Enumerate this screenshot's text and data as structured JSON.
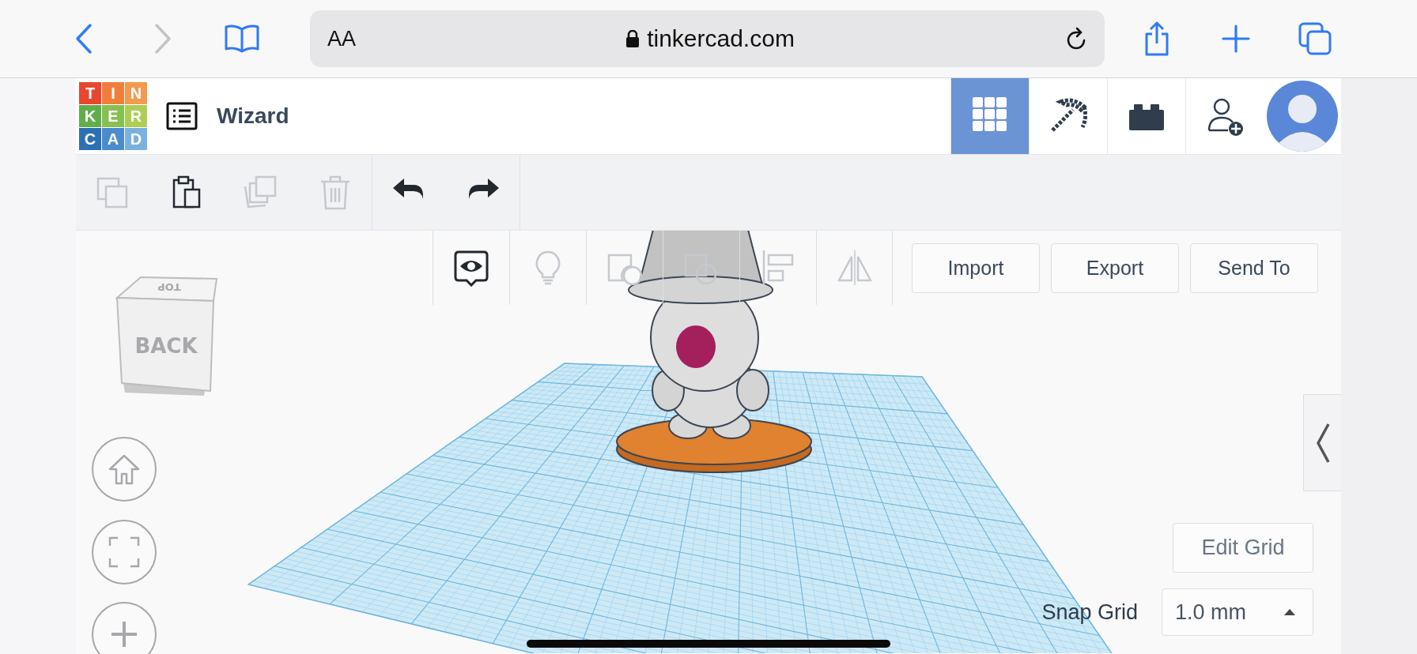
{
  "browser": {
    "nav": [
      {
        "kind": "back",
        "disabled": false
      },
      {
        "kind": "forward",
        "disabled": true
      }
    ],
    "text_size_button": "AA",
    "address": "tinkercad.com"
  },
  "app": {
    "logo": [
      {
        "letter": "T",
        "color": "#e8462f"
      },
      {
        "letter": "I",
        "color": "#ef7e3c"
      },
      {
        "letter": "N",
        "color": "#f29a4f"
      },
      {
        "letter": "K",
        "color": "#5fae4a"
      },
      {
        "letter": "E",
        "color": "#86c050"
      },
      {
        "letter": "R",
        "color": "#aecd57"
      },
      {
        "letter": "C",
        "color": "#2b70b4"
      },
      {
        "letter": "A",
        "color": "#4a8ccc"
      },
      {
        "letter": "D",
        "color": "#7ab1de"
      }
    ],
    "title": "Wizard",
    "view_toggles": [
      {
        "kind": "grid",
        "selected": true
      },
      {
        "kind": "pickaxe",
        "selected": false
      },
      {
        "kind": "bricks",
        "selected": false
      },
      {
        "kind": "invite",
        "selected": false
      }
    ],
    "edit_tools": [
      {
        "kind": "copy",
        "disabled": true
      },
      {
        "kind": "paste",
        "disabled": false
      },
      {
        "kind": "duplicate",
        "disabled": true
      },
      {
        "kind": "delete",
        "disabled": true
      }
    ],
    "history_tools": [
      {
        "kind": "undo",
        "disabled": false
      },
      {
        "kind": "redo",
        "disabled": false
      }
    ],
    "shape_tools": [
      {
        "kind": "notes",
        "disabled": false
      },
      {
        "kind": "light",
        "disabled": true
      },
      {
        "kind": "group",
        "disabled": true
      },
      {
        "kind": "ungroup",
        "disabled": true
      },
      {
        "kind": "align",
        "disabled": true
      },
      {
        "kind": "mirror",
        "disabled": true
      }
    ],
    "actions": [
      "Import",
      "Export",
      "Send To"
    ],
    "view_cube": {
      "front": "BACK",
      "top": "TOP"
    },
    "edit_grid": "Edit Grid",
    "snap_grid": {
      "label": "Snap Grid",
      "value": "1.0 mm"
    }
  }
}
